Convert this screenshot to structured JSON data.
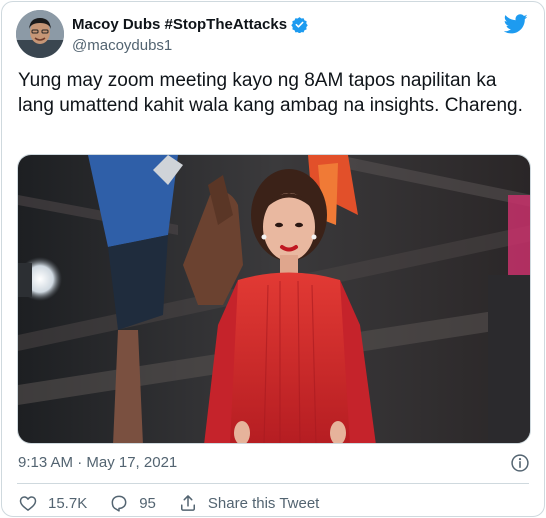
{
  "author": {
    "display_name": "Macoy Dubs #StopTheAttacks",
    "handle": "@macoydubs1",
    "verified": true
  },
  "tweet": {
    "text": "Yung may zoom meeting kayo ng 8AM tapos napilitan ka lang umattend kahit wala kang ambag na insights. Chareng.",
    "timestamp": "9:13 AM · May 17, 2021"
  },
  "actions": {
    "likes": "15.7K",
    "replies": "95",
    "share_label": "Share this Tweet"
  },
  "colors": {
    "brand_blue": "#1d9bf0",
    "text_primary": "#0f1419",
    "text_secondary": "#536471",
    "border": "#cfd9de",
    "dress_red": "#d8262b"
  },
  "icons": {
    "logo": "twitter-bird-icon",
    "verified": "verified-badge-icon",
    "info": "info-icon",
    "like": "heart-icon",
    "reply": "reply-bubble-icon",
    "share": "share-upload-icon"
  }
}
